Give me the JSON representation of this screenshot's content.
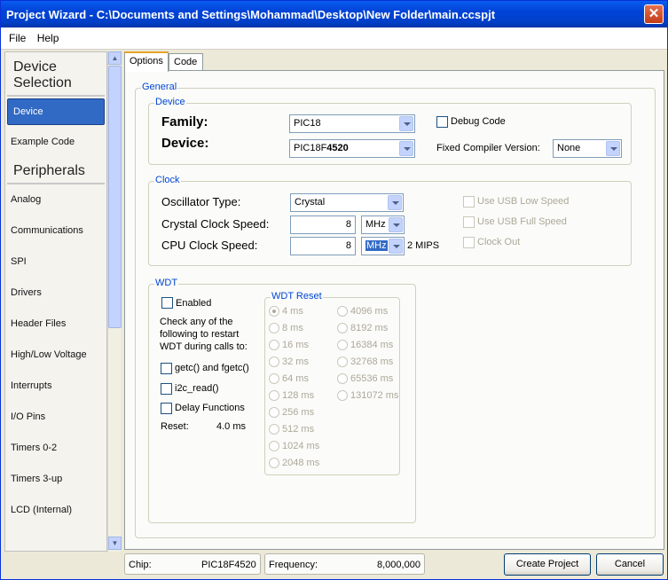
{
  "window": {
    "title": "Project Wizard - C:\\Documents and Settings\\Mohammad\\Desktop\\New Folder\\main.ccspjt",
    "close_glyph": "✕"
  },
  "menu": [
    "File",
    "Help"
  ],
  "sidebar": {
    "heading1": "Device Selection",
    "items1": [
      "Device",
      "Example Code"
    ],
    "heading2": "Peripherals",
    "items2": [
      "Analog",
      "Communications",
      "SPI",
      "Drivers",
      "Header Files",
      "High/Low Voltage",
      "Interrupts",
      "I/O Pins",
      "Timers 0-2",
      "Timers 3-up",
      "LCD (Internal)"
    ]
  },
  "tabs": [
    "Options",
    "Code"
  ],
  "general": {
    "legend": "General",
    "device": {
      "legend": "Device",
      "family_label": "Family:",
      "family_value": "PIC18",
      "device_label": "Device:",
      "device_value_prefix": "PIC18F",
      "device_value_bold": "4520",
      "debug_code": "Debug Code",
      "fixed_compiler_label": "Fixed Compiler Version:",
      "fixed_compiler_value": "None"
    },
    "clock": {
      "legend": "Clock",
      "osc_label": "Oscillator Type:",
      "osc_value": "Crystal",
      "crystal_label": "Crystal Clock Speed:",
      "crystal_value": "8",
      "crystal_unit": "MHz",
      "cpu_label": "CPU Clock Speed:",
      "cpu_value": "8",
      "cpu_unit": "MHz",
      "mips": "2 MIPS",
      "usb_low": "Use USB Low Speed",
      "usb_full": "Use USB Full Speed",
      "clock_out": "Clock Out"
    },
    "wdt": {
      "legend": "WDT",
      "enabled": "Enabled",
      "desc": [
        "Check any of the",
        "following to restart",
        "WDT during calls to:"
      ],
      "getc": "getc() and fgetc()",
      "i2c": "i2c_read()",
      "delay": "Delay Functions",
      "reset_label": "Reset:",
      "reset_value": "4.0 ms",
      "reset_group": {
        "legend": "WDT Reset",
        "col1": [
          "4 ms",
          "8 ms",
          "16 ms",
          "32 ms",
          "64 ms",
          "128 ms",
          "256 ms",
          "512 ms",
          "1024 ms",
          "2048 ms"
        ],
        "col2": [
          "4096 ms",
          "8192 ms",
          "16384 ms",
          "32768 ms",
          "65536 ms",
          "131072 ms"
        ]
      }
    }
  },
  "status": {
    "chip_label": "Chip:",
    "chip_value": "PIC18F4520",
    "freq_label": "Frequency:",
    "freq_value": "8,000,000"
  },
  "buttons": {
    "create": "Create Project",
    "cancel": "Cancel"
  }
}
